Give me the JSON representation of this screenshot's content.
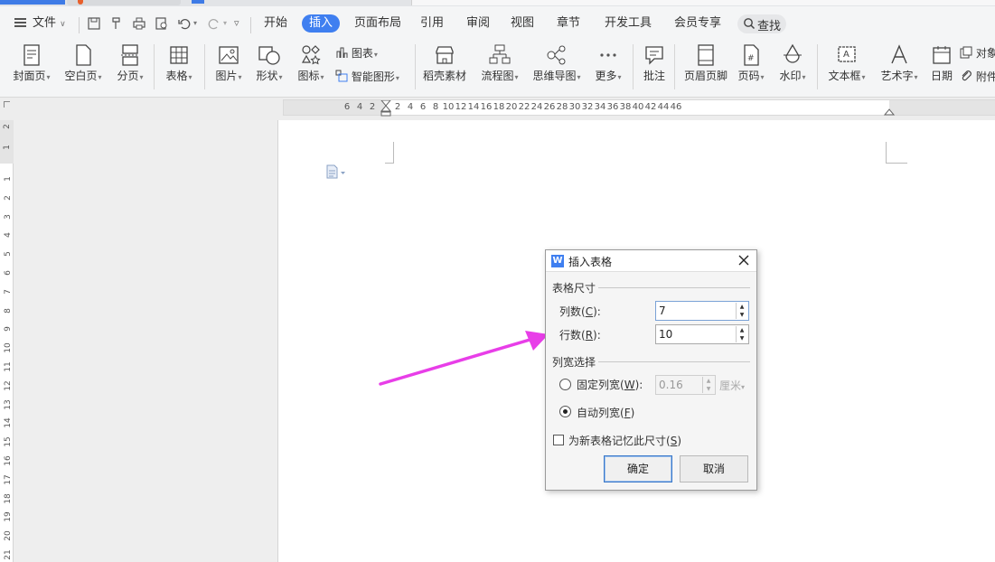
{
  "menu": {
    "file": "文件",
    "tabs": [
      "开始",
      "插入",
      "页面布局",
      "引用",
      "审阅",
      "视图",
      "章节",
      "开发工具",
      "会员专享"
    ],
    "active_tab": "插入",
    "search": "查找"
  },
  "ribbon": {
    "cover": "封面页",
    "blank": "空白页",
    "pagebreak": "分页",
    "table": "表格",
    "picture": "图片",
    "shape": "形状",
    "icon": "图标",
    "chart": "图表",
    "smartart": "智能图形",
    "daoke": "稻壳素材",
    "flowchart": "流程图",
    "mindmap": "思维导图",
    "more": "更多",
    "comment": "批注",
    "header_footer": "页眉页脚",
    "page_number": "页码",
    "watermark": "水印",
    "textbox": "文本框",
    "wordart": "艺术字",
    "date": "日期",
    "object": "对象",
    "attachment": "附件"
  },
  "ruler": {
    "h_left": [
      "6",
      "4",
      "2"
    ],
    "h_right": [
      "2",
      "4",
      "6",
      "8",
      "10",
      "12",
      "14",
      "16",
      "18",
      "20",
      "22",
      "24",
      "26",
      "28",
      "30",
      "32",
      "34",
      "36",
      "38",
      "40",
      "42",
      "44",
      "46"
    ],
    "v_top": [
      "2",
      "1"
    ],
    "v_main": [
      "1",
      "2",
      "3",
      "4",
      "5",
      "6",
      "7",
      "8",
      "9",
      "10",
      "11",
      "12",
      "13",
      "14",
      "15",
      "16",
      "17",
      "18",
      "19",
      "20",
      "21"
    ]
  },
  "dialog": {
    "title": "插入表格",
    "size_group": "表格尺寸",
    "columns_label": "列数(",
    "columns_key": "C",
    "columns_value": "7",
    "rows_label": "行数(",
    "rows_key": "R",
    "rows_value": "10",
    "width_group": "列宽选择",
    "fixed_label": "固定列宽(",
    "fixed_key": "W",
    "fixed_value": "0.16",
    "fixed_unit": "厘米",
    "auto_label": "自动列宽(",
    "auto_key": "F",
    "remember_label": "为新表格记忆此尺寸(",
    "remember_key": "S",
    "ok": "确定",
    "cancel": "取消",
    "label_close": "):",
    "paren_close": ")"
  },
  "colors": {
    "accent": "#3f7ff0",
    "arrow": "#e83ee8"
  }
}
